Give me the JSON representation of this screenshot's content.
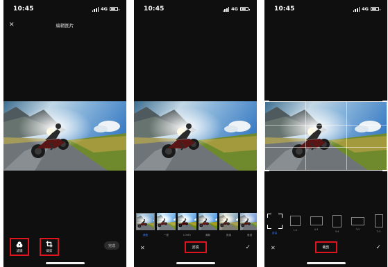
{
  "status_bar": {
    "time": "10:45",
    "network": "4G"
  },
  "screen1": {
    "title": "编辑图片",
    "tools": [
      {
        "label": "滤镜",
        "icon": "filter-icon"
      },
      {
        "label": "裁剪",
        "icon": "crop-icon"
      }
    ],
    "done_label": "完成"
  },
  "screen2": {
    "filters": [
      "原图",
      "一夏",
      "LOMO",
      "清新",
      "质感",
      "浪漫"
    ],
    "selected_filter_index": 0,
    "confirm_button_label": "滤镜"
  },
  "screen3": {
    "ratios": [
      "自由",
      "1:1",
      "4:3",
      "3:4",
      "3:2",
      "2:3"
    ],
    "selected_ratio_index": 0,
    "confirm_button_label": "裁剪"
  },
  "colors": {
    "highlight": "#e0141e",
    "accent": "#3c86ff"
  }
}
